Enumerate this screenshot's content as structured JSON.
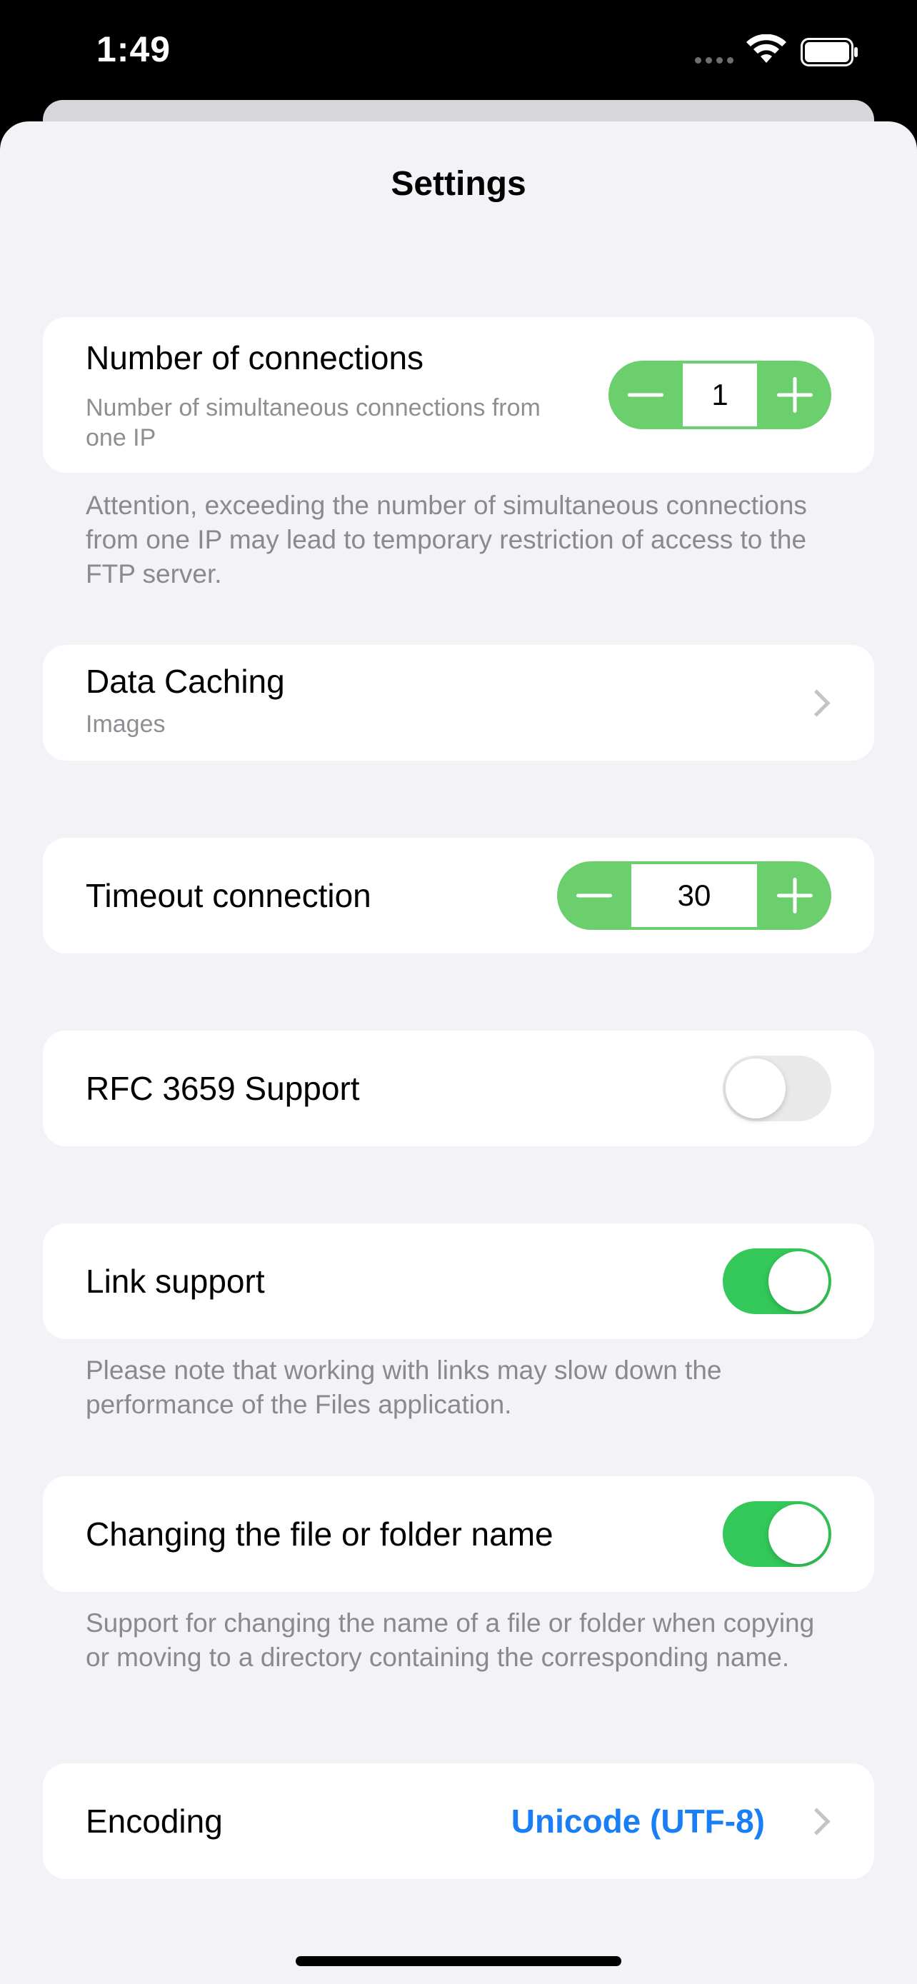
{
  "status_bar": {
    "time": "1:49",
    "icons": [
      "cellular-signal-icon",
      "wifi-icon",
      "battery-icon"
    ]
  },
  "header": {
    "title": "Settings"
  },
  "connections": {
    "label": "Number of connections",
    "subtitle": "Number of simultaneous connections from one IP",
    "value": "1",
    "note": "Attention, exceeding the number of simultaneous connections from one IP may lead to temporary restriction of access to the FTP server."
  },
  "data_caching": {
    "label": "Data Caching",
    "subtitle": "Images"
  },
  "timeout": {
    "label": "Timeout connection",
    "value": "30"
  },
  "rfc3659": {
    "label": "RFC 3659 Support",
    "enabled": false
  },
  "link_support": {
    "label": "Link support",
    "enabled": true,
    "note": "Please note that working with links may slow down the performance of the Files application."
  },
  "rename": {
    "label": "Changing the file or folder name",
    "enabled": true,
    "note": "Support for changing the name of a file or folder when copying or moving to a directory containing the corresponding name."
  },
  "encoding": {
    "label": "Encoding",
    "value": "Unicode (UTF-8)"
  },
  "colors": {
    "accent_blue": "#1a7ef5",
    "toggle_on": "#34c759",
    "stepper_green": "#6ccf6e",
    "background": "#f2f2f7"
  }
}
